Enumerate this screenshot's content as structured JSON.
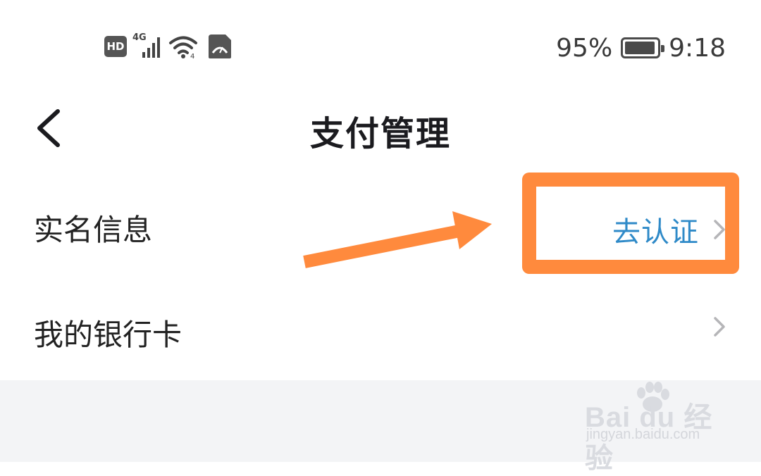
{
  "status_bar": {
    "network_badge": "HD",
    "network_type": "4G",
    "battery_percent": "95%",
    "battery_level": 0.95,
    "time": "9:18",
    "icons": [
      "hd-icon",
      "signal-icon",
      "wifi-icon",
      "speed-icon",
      "battery-icon"
    ]
  },
  "header": {
    "title": "支付管理",
    "back_icon": "chevron-left-icon"
  },
  "rows": [
    {
      "label": "实名信息",
      "action": "去认证",
      "chevron_icon": "chevron-right-icon"
    },
    {
      "label": "我的银行卡",
      "action": "",
      "chevron_icon": "chevron-right-icon"
    }
  ],
  "colors": {
    "action_text": "#2f8ac8",
    "annotation": "#ff8a3d",
    "section_gap": "#f3f4f6"
  },
  "watermark": {
    "main": "Bai du 经验",
    "sub": "jingyan.baidu.com"
  }
}
